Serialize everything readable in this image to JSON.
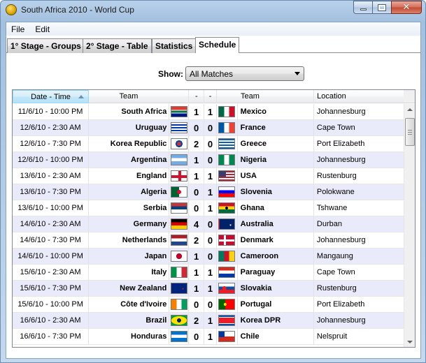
{
  "window": {
    "title": "South Africa 2010 - World Cup"
  },
  "menu": [
    {
      "label": "File"
    },
    {
      "label": "Edit"
    }
  ],
  "tabs": [
    {
      "label": "1° Stage - Groups"
    },
    {
      "label": "2° Stage - Table"
    },
    {
      "label": "Statistics"
    },
    {
      "label": "Schedule"
    }
  ],
  "filter": {
    "label": "Show:",
    "value": "All Matches"
  },
  "table": {
    "columns": {
      "date": "Date - Time",
      "team": "Team",
      "score1": "-",
      "score2": "-",
      "team2": "Team",
      "location": "Location"
    },
    "rows": [
      {
        "date": "11/6/10 - 10:00 PM",
        "team1": "South Africa",
        "flag1": "south-africa",
        "s1": "1",
        "s2": "1",
        "flag2": "mexico",
        "team2": "Mexico",
        "location": "Johannesburg"
      },
      {
        "date": "12/6/10 - 2:30 AM",
        "team1": "Uruguay",
        "flag1": "uruguay",
        "s1": "0",
        "s2": "0",
        "flag2": "france",
        "team2": "France",
        "location": "Cape Town"
      },
      {
        "date": "12/6/10 - 7:30 PM",
        "team1": "Korea Republic",
        "flag1": "korea-republic",
        "s1": "2",
        "s2": "0",
        "flag2": "greece",
        "team2": "Greece",
        "location": "Port Elizabeth"
      },
      {
        "date": "12/6/10 - 10:00 PM",
        "team1": "Argentina",
        "flag1": "argentina",
        "s1": "1",
        "s2": "0",
        "flag2": "nigeria",
        "team2": "Nigeria",
        "location": "Johannesburg"
      },
      {
        "date": "13/6/10 - 2:30 AM",
        "team1": "England",
        "flag1": "england",
        "s1": "1",
        "s2": "1",
        "flag2": "usa",
        "team2": "USA",
        "location": "Rustenburg"
      },
      {
        "date": "13/6/10 - 7:30 PM",
        "team1": "Algeria",
        "flag1": "algeria",
        "s1": "0",
        "s2": "1",
        "flag2": "slovenia",
        "team2": "Slovenia",
        "location": "Polokwane"
      },
      {
        "date": "13/6/10 - 10:00 PM",
        "team1": "Serbia",
        "flag1": "serbia",
        "s1": "0",
        "s2": "1",
        "flag2": "ghana",
        "team2": "Ghana",
        "location": "Tshwane"
      },
      {
        "date": "14/6/10 - 2:30 AM",
        "team1": "Germany",
        "flag1": "germany",
        "s1": "4",
        "s2": "0",
        "flag2": "australia",
        "team2": "Australia",
        "location": "Durban"
      },
      {
        "date": "14/6/10 - 7:30 PM",
        "team1": "Netherlands",
        "flag1": "netherlands",
        "s1": "2",
        "s2": "0",
        "flag2": "denmark",
        "team2": "Denmark",
        "location": "Johannesburg"
      },
      {
        "date": "14/6/10 - 10:00 PM",
        "team1": "Japan",
        "flag1": "japan",
        "s1": "1",
        "s2": "0",
        "flag2": "cameroon",
        "team2": "Cameroon",
        "location": "Mangaung"
      },
      {
        "date": "15/6/10 - 2:30 AM",
        "team1": "Italy",
        "flag1": "italy",
        "s1": "1",
        "s2": "1",
        "flag2": "paraguay",
        "team2": "Paraguay",
        "location": "Cape Town"
      },
      {
        "date": "15/6/10 - 7:30 PM",
        "team1": "New Zealand",
        "flag1": "new-zealand",
        "s1": "1",
        "s2": "1",
        "flag2": "slovakia",
        "team2": "Slovakia",
        "location": "Rustenburg"
      },
      {
        "date": "15/6/10 - 10:00 PM",
        "team1": "Côte d'Ivoire",
        "flag1": "cote-divoire",
        "s1": "0",
        "s2": "0",
        "flag2": "portugal",
        "team2": "Portugal",
        "location": "Port Elizabeth"
      },
      {
        "date": "16/6/10 - 2:30 AM",
        "team1": "Brazil",
        "flag1": "brazil",
        "s1": "2",
        "s2": "1",
        "flag2": "korea-dpr",
        "team2": "Korea DPR",
        "location": "Johannesburg"
      },
      {
        "date": "16/6/10 - 7:30 PM",
        "team1": "Honduras",
        "flag1": "honduras",
        "s1": "0",
        "s2": "1",
        "flag2": "chile",
        "team2": "Chile",
        "location": "Nelspruit"
      }
    ]
  }
}
